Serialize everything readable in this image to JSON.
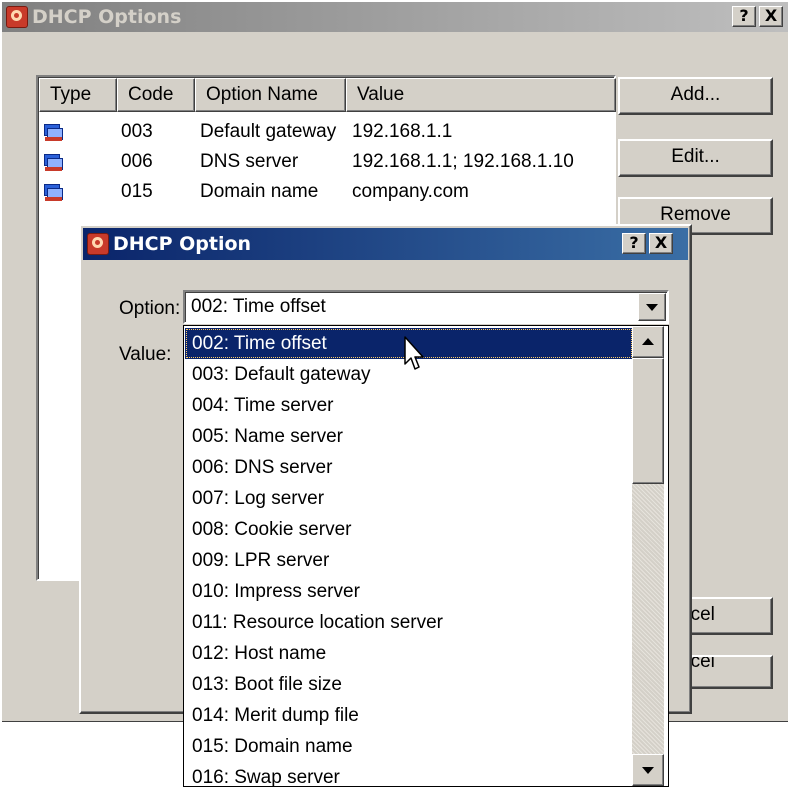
{
  "outer_dialog": {
    "title": "DHCP Options",
    "help_label": "?",
    "close_label": "X",
    "icon": "dhcp-app-icon",
    "columns": [
      "Type",
      "Code",
      "Option Name",
      "Value"
    ],
    "rows": [
      {
        "icon": "network-computer-icon",
        "code": "003",
        "name": "Default gateway",
        "value": "192.168.1.1"
      },
      {
        "icon": "network-computer-icon",
        "code": "006",
        "name": "DNS server",
        "value": "192.168.1.1; 192.168.1.10"
      },
      {
        "icon": "network-computer-icon",
        "code": "015",
        "name": "Domain name",
        "value": "company.com"
      }
    ],
    "buttons": {
      "add": "Add...",
      "edit": "Edit...",
      "remove": "Remove",
      "cancel": "ncel",
      "bottom": "ncel"
    }
  },
  "inner_dialog": {
    "title": "DHCP Option",
    "help_label": "?",
    "close_label": "X",
    "icon": "dhcp-app-icon",
    "option_label": "Option:",
    "value_label": "Value:",
    "selected_option": "002: Time offset",
    "options": [
      "002: Time offset",
      "003: Default gateway",
      "004: Time server",
      "005: Name server",
      "006: DNS server",
      "007: Log server",
      "008: Cookie server",
      "009: LPR server",
      "010: Impress server",
      "011: Resource location server",
      "012: Host name",
      "013: Boot file size",
      "014: Merit dump file",
      "015: Domain name",
      "016: Swap server"
    ]
  },
  "colors": {
    "dialog_face": "#d4d0c8",
    "selection": "#0a246a",
    "inactive_title": "#808080",
    "active_title": "#0a246a"
  }
}
